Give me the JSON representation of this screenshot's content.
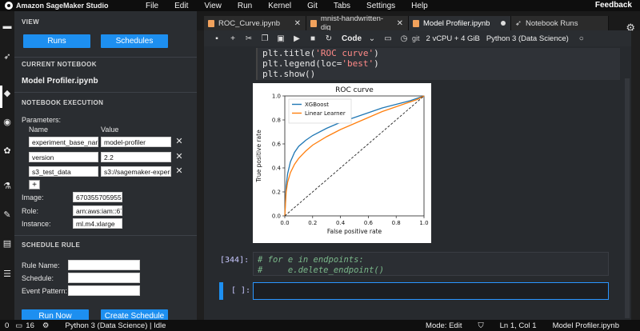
{
  "app": {
    "title": "Amazon SageMaker Studio",
    "feedback": "Feedback"
  },
  "menu": [
    "File",
    "Edit",
    "View",
    "Run",
    "Kernel",
    "Git",
    "Tabs",
    "Settings",
    "Help"
  ],
  "sidebar": {
    "view_header": "VIEW",
    "runs_btn": "Runs",
    "schedules_btn": "Schedules",
    "current_notebook_header": "CURRENT NOTEBOOK",
    "notebook_name": "Model Profiler.ipynb",
    "execution_header": "NOTEBOOK EXECUTION",
    "parameters_label": "Parameters:",
    "name_col": "Name",
    "value_col": "Value",
    "params": [
      {
        "name": "experiment_base_name",
        "value": "model-profiler"
      },
      {
        "name": "version",
        "value": "2.2"
      },
      {
        "name": "s3_test_data",
        "value": "s3://sagemaker-experiments"
      }
    ],
    "add_param": "+",
    "image_label": "Image:",
    "image_value": "670355705955.dkr.ecr",
    "role_label": "Role:",
    "role_value": "arn:aws:iam::670355705",
    "instance_label": "Instance:",
    "instance_value": "ml.m4.xlarge",
    "schedule_header": "SCHEDULE RULE",
    "rule_name_label": "Rule Name:",
    "schedule_label": "Schedule:",
    "event_pattern_label": "Event Pattern:",
    "run_now_btn": "Run Now",
    "create_schedule_btn": "Create Schedule"
  },
  "tabs": [
    {
      "label": "ROC_Curve.ipynb"
    },
    {
      "label": "mnist-handwritten-dig"
    },
    {
      "label": "Model Profiler.ipynb"
    },
    {
      "label": "Notebook Runs"
    }
  ],
  "toolbar": {
    "cell_type": "Code",
    "git": "git",
    "resources": "2 vCPU + 4 GiB",
    "kernel": "Python 3 (Data Science)"
  },
  "code": {
    "line1_a": "plt.title(",
    "line1_s": "'ROC curve'",
    "line1_b": ")",
    "line2_a": "plt.legend(loc=",
    "line2_s": "'best'",
    "line2_b": ")",
    "line3": "plt.show()"
  },
  "cells": {
    "cell2_prompt": "[344]:",
    "cell2_line1": "# for e in endpoints:",
    "cell2_line2": "#     e.delete_endpoint()",
    "cell3_prompt": "[ ]:"
  },
  "status": {
    "zero": "0",
    "count": "16",
    "kernel": "Python 3 (Data Science) | Idle",
    "mode": "Mode: Edit",
    "position": "Ln 1, Col 1",
    "file": "Model Profiler.ipynb"
  },
  "chart_data": {
    "type": "line",
    "title": "ROC curve",
    "xlabel": "False positive rate",
    "ylabel": "True positive rate",
    "xlim": [
      0,
      1
    ],
    "ylim": [
      0,
      1
    ],
    "xticks": [
      "0.0",
      "0.2",
      "0.4",
      "0.6",
      "0.8",
      "1.0"
    ],
    "yticks": [
      "0.0",
      "0.2",
      "0.4",
      "0.6",
      "0.8",
      "1.0"
    ],
    "legend": "top-left",
    "series": [
      {
        "name": "XGBoost",
        "color": "#1f77b4",
        "x": [
          0,
          0.01,
          0.02,
          0.04,
          0.07,
          0.1,
          0.15,
          0.2,
          0.3,
          0.4,
          0.5,
          0.6,
          0.7,
          0.8,
          0.9,
          0.95,
          1.0
        ],
        "y": [
          0,
          0.25,
          0.35,
          0.45,
          0.53,
          0.58,
          0.63,
          0.67,
          0.73,
          0.78,
          0.82,
          0.86,
          0.9,
          0.93,
          0.96,
          0.98,
          1.0
        ]
      },
      {
        "name": "Linear Learner",
        "color": "#ff7f0e",
        "x": [
          0,
          0.01,
          0.02,
          0.04,
          0.07,
          0.1,
          0.15,
          0.2,
          0.3,
          0.4,
          0.5,
          0.6,
          0.7,
          0.8,
          0.9,
          0.95,
          1.0
        ],
        "y": [
          0,
          0.2,
          0.28,
          0.36,
          0.43,
          0.48,
          0.54,
          0.59,
          0.66,
          0.72,
          0.77,
          0.82,
          0.87,
          0.91,
          0.95,
          0.97,
          1.0
        ]
      },
      {
        "name": "",
        "color": "#222222",
        "dashed": true,
        "x": [
          0,
          1
        ],
        "y": [
          0,
          1
        ]
      }
    ]
  }
}
